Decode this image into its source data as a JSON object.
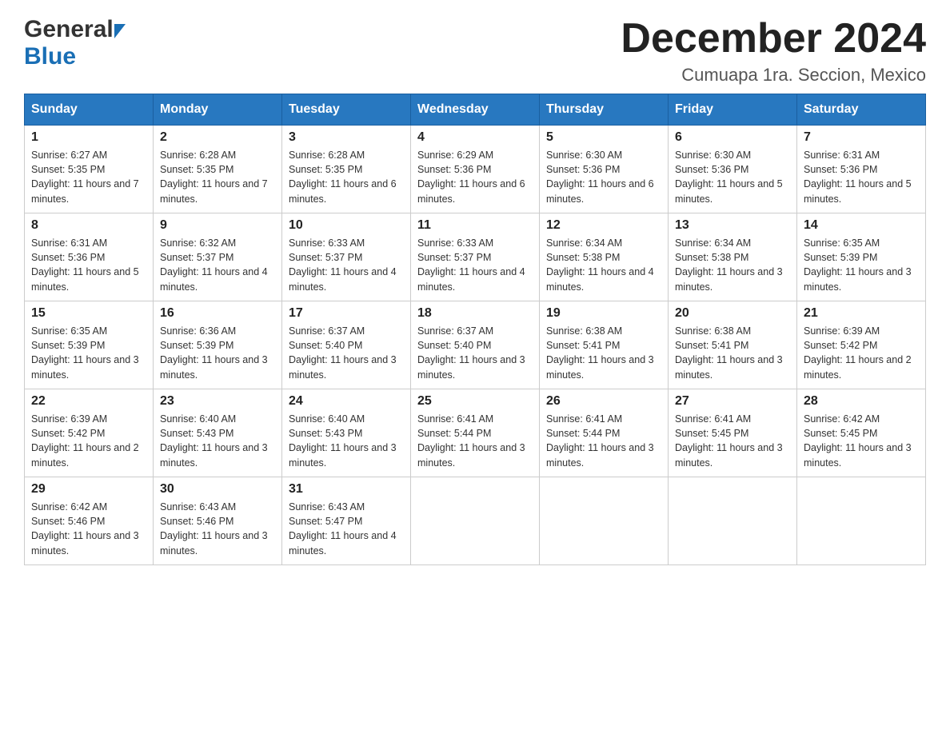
{
  "header": {
    "logo_general": "General",
    "logo_blue": "Blue",
    "month_title": "December 2024",
    "location": "Cumuapa 1ra. Seccion, Mexico"
  },
  "weekdays": [
    "Sunday",
    "Monday",
    "Tuesday",
    "Wednesday",
    "Thursday",
    "Friday",
    "Saturday"
  ],
  "weeks": [
    [
      {
        "day": "1",
        "sunrise": "6:27 AM",
        "sunset": "5:35 PM",
        "daylight": "11 hours and 7 minutes."
      },
      {
        "day": "2",
        "sunrise": "6:28 AM",
        "sunset": "5:35 PM",
        "daylight": "11 hours and 7 minutes."
      },
      {
        "day": "3",
        "sunrise": "6:28 AM",
        "sunset": "5:35 PM",
        "daylight": "11 hours and 6 minutes."
      },
      {
        "day": "4",
        "sunrise": "6:29 AM",
        "sunset": "5:36 PM",
        "daylight": "11 hours and 6 minutes."
      },
      {
        "day": "5",
        "sunrise": "6:30 AM",
        "sunset": "5:36 PM",
        "daylight": "11 hours and 6 minutes."
      },
      {
        "day": "6",
        "sunrise": "6:30 AM",
        "sunset": "5:36 PM",
        "daylight": "11 hours and 5 minutes."
      },
      {
        "day": "7",
        "sunrise": "6:31 AM",
        "sunset": "5:36 PM",
        "daylight": "11 hours and 5 minutes."
      }
    ],
    [
      {
        "day": "8",
        "sunrise": "6:31 AM",
        "sunset": "5:36 PM",
        "daylight": "11 hours and 5 minutes."
      },
      {
        "day": "9",
        "sunrise": "6:32 AM",
        "sunset": "5:37 PM",
        "daylight": "11 hours and 4 minutes."
      },
      {
        "day": "10",
        "sunrise": "6:33 AM",
        "sunset": "5:37 PM",
        "daylight": "11 hours and 4 minutes."
      },
      {
        "day": "11",
        "sunrise": "6:33 AM",
        "sunset": "5:37 PM",
        "daylight": "11 hours and 4 minutes."
      },
      {
        "day": "12",
        "sunrise": "6:34 AM",
        "sunset": "5:38 PM",
        "daylight": "11 hours and 4 minutes."
      },
      {
        "day": "13",
        "sunrise": "6:34 AM",
        "sunset": "5:38 PM",
        "daylight": "11 hours and 3 minutes."
      },
      {
        "day": "14",
        "sunrise": "6:35 AM",
        "sunset": "5:39 PM",
        "daylight": "11 hours and 3 minutes."
      }
    ],
    [
      {
        "day": "15",
        "sunrise": "6:35 AM",
        "sunset": "5:39 PM",
        "daylight": "11 hours and 3 minutes."
      },
      {
        "day": "16",
        "sunrise": "6:36 AM",
        "sunset": "5:39 PM",
        "daylight": "11 hours and 3 minutes."
      },
      {
        "day": "17",
        "sunrise": "6:37 AM",
        "sunset": "5:40 PM",
        "daylight": "11 hours and 3 minutes."
      },
      {
        "day": "18",
        "sunrise": "6:37 AM",
        "sunset": "5:40 PM",
        "daylight": "11 hours and 3 minutes."
      },
      {
        "day": "19",
        "sunrise": "6:38 AM",
        "sunset": "5:41 PM",
        "daylight": "11 hours and 3 minutes."
      },
      {
        "day": "20",
        "sunrise": "6:38 AM",
        "sunset": "5:41 PM",
        "daylight": "11 hours and 3 minutes."
      },
      {
        "day": "21",
        "sunrise": "6:39 AM",
        "sunset": "5:42 PM",
        "daylight": "11 hours and 2 minutes."
      }
    ],
    [
      {
        "day": "22",
        "sunrise": "6:39 AM",
        "sunset": "5:42 PM",
        "daylight": "11 hours and 2 minutes."
      },
      {
        "day": "23",
        "sunrise": "6:40 AM",
        "sunset": "5:43 PM",
        "daylight": "11 hours and 3 minutes."
      },
      {
        "day": "24",
        "sunrise": "6:40 AM",
        "sunset": "5:43 PM",
        "daylight": "11 hours and 3 minutes."
      },
      {
        "day": "25",
        "sunrise": "6:41 AM",
        "sunset": "5:44 PM",
        "daylight": "11 hours and 3 minutes."
      },
      {
        "day": "26",
        "sunrise": "6:41 AM",
        "sunset": "5:44 PM",
        "daylight": "11 hours and 3 minutes."
      },
      {
        "day": "27",
        "sunrise": "6:41 AM",
        "sunset": "5:45 PM",
        "daylight": "11 hours and 3 minutes."
      },
      {
        "day": "28",
        "sunrise": "6:42 AM",
        "sunset": "5:45 PM",
        "daylight": "11 hours and 3 minutes."
      }
    ],
    [
      {
        "day": "29",
        "sunrise": "6:42 AM",
        "sunset": "5:46 PM",
        "daylight": "11 hours and 3 minutes."
      },
      {
        "day": "30",
        "sunrise": "6:43 AM",
        "sunset": "5:46 PM",
        "daylight": "11 hours and 3 minutes."
      },
      {
        "day": "31",
        "sunrise": "6:43 AM",
        "sunset": "5:47 PM",
        "daylight": "11 hours and 4 minutes."
      },
      null,
      null,
      null,
      null
    ]
  ]
}
